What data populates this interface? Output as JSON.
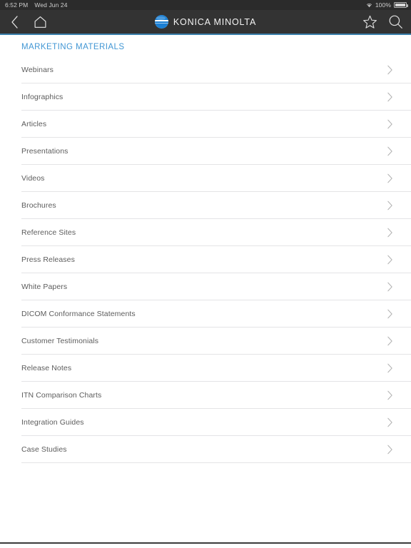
{
  "status_bar": {
    "time": "6:52 PM",
    "date": "Wed Jun 24",
    "battery_percent": "100%",
    "wifi_icon": "wifi-icon",
    "battery_icon": "battery-full-icon"
  },
  "nav_bar": {
    "back_icon": "chevron-left-icon",
    "home_icon": "home-icon",
    "favorite_icon": "star-outline-icon",
    "search_icon": "search-icon",
    "brand_name": "KONICA MINOLTA",
    "brand_mark_icon": "konica-minolta-logo-icon",
    "background_color": "#333333",
    "accent_color": "#3b80ab"
  },
  "main": {
    "section_title": "MARKETING MATERIALS",
    "section_title_color": "#4096d4",
    "row_chevron_icon": "chevron-right-icon",
    "items": [
      {
        "label": "Webinars"
      },
      {
        "label": "Infographics"
      },
      {
        "label": "Articles"
      },
      {
        "label": "Presentations"
      },
      {
        "label": "Videos"
      },
      {
        "label": "Brochures"
      },
      {
        "label": "Reference Sites"
      },
      {
        "label": "Press Releases"
      },
      {
        "label": "White Papers"
      },
      {
        "label": "DICOM Conformance Statements"
      },
      {
        "label": "Customer Testimonials"
      },
      {
        "label": "Release Notes"
      },
      {
        "label": "ITN Comparison Charts"
      },
      {
        "label": "Integration Guides"
      },
      {
        "label": "Case Studies"
      }
    ]
  }
}
